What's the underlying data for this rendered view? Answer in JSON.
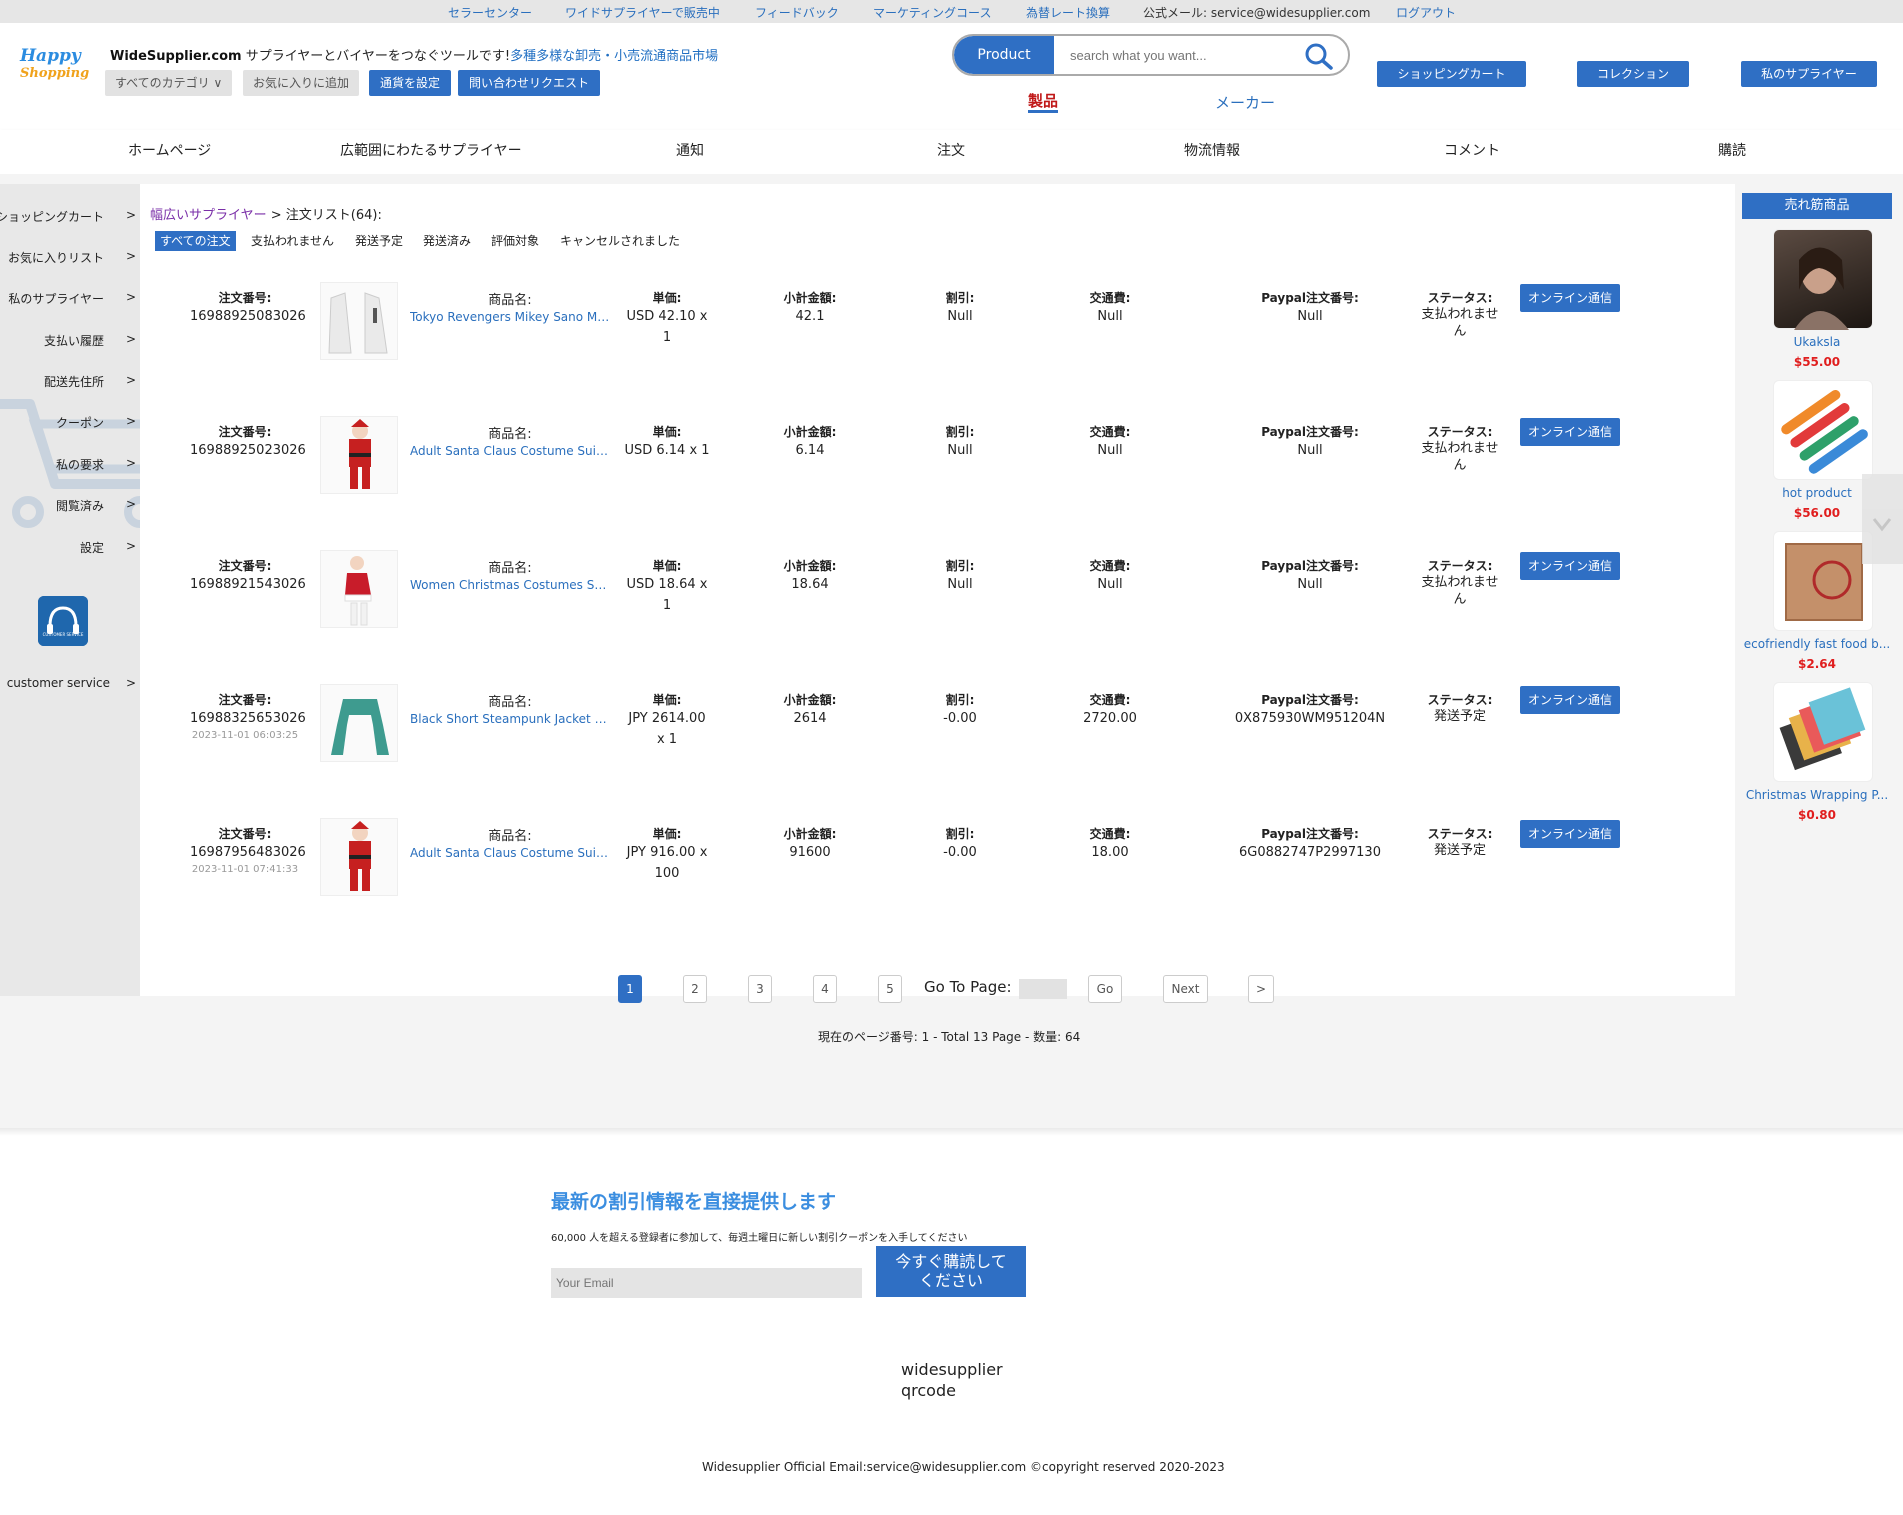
{
  "topbar": {
    "links": [
      "セラーセンター",
      "ワイドサプライヤーで販売中",
      "フィードバック",
      "マーケティングコース",
      "為替レート換算"
    ],
    "email": "公式メール: service@widesupplier.com",
    "logout": "ログアウト"
  },
  "logo": {
    "line1": "Happy",
    "line2": "Shopping"
  },
  "brand": {
    "name": "WideSupplier.com",
    "tagline": " サプライヤーとバイヤーをつなぐツールです!",
    "highlight": "多種多様な卸売・小売流通商品市場"
  },
  "header_buttons": {
    "categories": "すべてのカテゴリ ∨",
    "add_fav": "お気に入りに追加",
    "currency": "通貨を設定",
    "inquiry": "問い合わせリクエスト"
  },
  "search": {
    "type_label": "Product",
    "placeholder": "search what you want..."
  },
  "search_tabs": {
    "product": "製品",
    "maker": "メーカー"
  },
  "right_buttons": {
    "cart": "ショッピングカート",
    "collection": "コレクション",
    "suppliers": "私のサプライヤー"
  },
  "nav": [
    "ホームページ",
    "広範囲にわたるサプライヤー",
    "通知",
    "注文",
    "物流情報",
    "コメント",
    "購読"
  ],
  "sidebar": {
    "items": [
      "ショッピングカート",
      "お気に入りリスト",
      "私のサプライヤー",
      "支払い履歴",
      "配送先住所",
      "クーポン",
      "私の要求",
      "閲覧済み",
      "設定"
    ],
    "arrow": ">",
    "customer_service": "customer service",
    "cs_badge": "CUSTOMER SERVICE"
  },
  "breadcrumb": {
    "link": "幅広いサプライヤー",
    "sep": " > ",
    "current": "注文リスト(64):"
  },
  "filters": [
    "すべての注文",
    "支払われません",
    "発送予定",
    "発送済み",
    "評価対象",
    "キャンセルされました"
  ],
  "labels": {
    "order_no": "注文番号:",
    "product": "商品名:",
    "unit_price": "単価:",
    "subtotal": "小計金額:",
    "discount": "割引:",
    "shipping": "交通費:",
    "paypal": "Paypal注文番号:",
    "status": "ステータス:",
    "online": "オンライン通信"
  },
  "orders": [
    {
      "order_no": "16988925083026",
      "date": "",
      "product": "Tokyo Revengers Mikey Sano Ma...",
      "price1": "USD 42.10 x",
      "price2": "1",
      "subtotal": "42.1",
      "discount": "Null",
      "shipping": "Null",
      "paypal": "Null",
      "status1": "支払われませ",
      "status2": "ん"
    },
    {
      "order_no": "16988925023026",
      "date": "",
      "product": "Adult Santa Claus Costume Suit ...",
      "price1": "USD 6.14 x 1",
      "price2": "",
      "subtotal": "6.14",
      "discount": "Null",
      "shipping": "Null",
      "paypal": "Null",
      "status1": "支払われませ",
      "status2": "ん"
    },
    {
      "order_no": "16988921543026",
      "date": "",
      "product": "Women Christmas Costumes Sex...",
      "price1": "USD 18.64 x",
      "price2": "1",
      "subtotal": "18.64",
      "discount": "Null",
      "shipping": "Null",
      "paypal": "Null",
      "status1": "支払われませ",
      "status2": "ん"
    },
    {
      "order_no": "16988325653026",
      "date": "2023-11-01 06:03:25",
      "product": "Black Short Steampunk Jacket Lo...",
      "price1": "JPY 2614.00",
      "price2": "x 1",
      "subtotal": "2614",
      "discount": "-0.00",
      "shipping": "2720.00",
      "paypal": "0X875930WM951204N",
      "status1": "発送予定",
      "status2": ""
    },
    {
      "order_no": "16987956483026",
      "date": "2023-11-01 07:41:33",
      "product": "Adult Santa Claus Costume Suit ...",
      "price1": "JPY 916.00 x",
      "price2": "100",
      "subtotal": "91600",
      "discount": "-0.00",
      "shipping": "18.00",
      "paypal": "6G0882747P2997130",
      "status1": "発送予定",
      "status2": ""
    }
  ],
  "pagination": {
    "pages": [
      "1",
      "2",
      "3",
      "4",
      "5"
    ],
    "goto_label": "Go To Page:",
    "go": "Go",
    "next": "Next",
    "last": ">",
    "summary": "現在のページ番号: 1 - Total 13 Page - 数量: 64"
  },
  "hot_products": {
    "title": "売れ筋商品",
    "items": [
      {
        "name": "Ukaksla",
        "price": "$55.00"
      },
      {
        "name": "hot product",
        "price": "$56.00"
      },
      {
        "name": "ecofriendly fast food b...",
        "price": "$2.64"
      },
      {
        "name": "Christmas Wrapping P...",
        "price": "$0.80"
      }
    ]
  },
  "newsletter": {
    "title": "最新の割引情報を直接提供します",
    "subtitle": "60,000 人を超える登録者に参加して、毎週土曜日に新しい割引クーポンを入手してください",
    "email_placeholder": "Your Email",
    "subscribe_line1": "今すぐ購読して",
    "subscribe_line2": "ください"
  },
  "qrcode": {
    "line1": "widesupplier",
    "line2": "qrcode"
  },
  "footer": "Widesupplier Official Email:service@widesupplier.com ©copyright reserved 2020-2023"
}
